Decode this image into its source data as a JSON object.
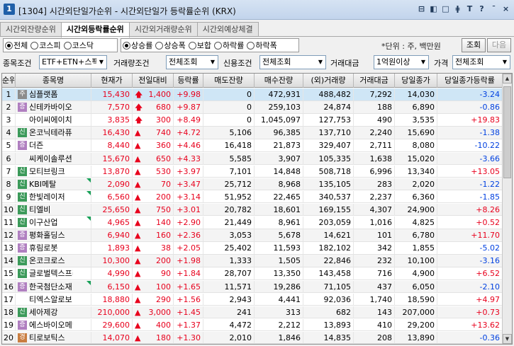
{
  "window": {
    "icon_label": "1",
    "title": "[1304] 시간외단일가순위 - 시간외단일가 등락률순위 (KRX)",
    "buttons": [
      "⊟",
      "◧",
      "□",
      "ǂ",
      "T",
      "?",
      "ˉ",
      "×"
    ]
  },
  "tabs": [
    "시간외잔량순위",
    "시간외등락률순위",
    "시간외거래량순위",
    "시간외예상체결"
  ],
  "active_tab": 1,
  "market_radios": [
    {
      "label": "전체",
      "on": true
    },
    {
      "label": "코스피",
      "on": false
    },
    {
      "label": "코스닥",
      "on": false
    },
    {
      "label": "ETF+ETN+스팩 제외",
      "on": false
    }
  ],
  "direction_radios": [
    {
      "label": "상승률",
      "on": true
    },
    {
      "label": "상승폭",
      "on": false
    },
    {
      "label": "보합",
      "on": false
    },
    {
      "label": "하락률",
      "on": false
    },
    {
      "label": "하락폭",
      "on": false
    }
  ],
  "unit_text": "*단위 : 주, 백만원",
  "query_button": "조회",
  "next_button": "다음",
  "filters": {
    "stock_cond_label": "종목조건",
    "stock_cond_value": "ETF+ETN+스팩 제외",
    "volume_cond_label": "거래량조건",
    "volume_cond_value": "전체조회",
    "credit_cond_label": "신용조건",
    "credit_cond_value": "전체조회",
    "amount_label": "거래대금",
    "amount_value": "1억원이상",
    "price_label": "가격",
    "price_value": "전체조회"
  },
  "columns": [
    "순위",
    "종목명",
    "현재가",
    "전일대비",
    "등락률",
    "매도잔량",
    "매수잔량",
    "(외)거래량",
    "거래대금",
    "당일종가",
    "당일종가등락률"
  ],
  "rows": [
    {
      "rank": "1",
      "badge": "주",
      "badge_type": "ju",
      "name": "심플랫폼",
      "corner": false,
      "price": "15,430",
      "arrow": "🡅",
      "arrow_type": "limit",
      "change": "1,400",
      "rate": "+9.98",
      "sell": "0",
      "buy": "472,931",
      "volume": "488,482",
      "amount": "7,292",
      "close": "14,030",
      "close_rate": "-3.24",
      "close_color": "blue"
    },
    {
      "rank": "2",
      "badge": "증",
      "badge_type": "jeung",
      "name": "신테카바이오",
      "corner": false,
      "price": "7,570",
      "arrow": "🡅",
      "arrow_type": "limit",
      "change": "680",
      "rate": "+9.87",
      "sell": "0",
      "buy": "259,103",
      "volume": "24,874",
      "amount": "188",
      "close": "6,890",
      "close_rate": "-0.86",
      "close_color": "blue"
    },
    {
      "rank": "3",
      "badge": "",
      "badge_type": "",
      "name": "아이씨에이치",
      "corner": false,
      "price": "3,835",
      "arrow": "🡅",
      "arrow_type": "limit",
      "change": "300",
      "rate": "+8.49",
      "sell": "0",
      "buy": "1,045,097",
      "volume": "127,753",
      "amount": "490",
      "close": "3,535",
      "close_rate": "+19.83",
      "close_color": "red"
    },
    {
      "rank": "4",
      "badge": "신",
      "badge_type": "sin",
      "name": "온코닉테라퓨",
      "corner": false,
      "price": "16,430",
      "arrow": "▲",
      "arrow_type": "up",
      "change": "740",
      "rate": "+4.72",
      "sell": "5,106",
      "buy": "96,385",
      "volume": "137,710",
      "amount": "2,240",
      "close": "15,690",
      "close_rate": "-1.38",
      "close_color": "blue"
    },
    {
      "rank": "5",
      "badge": "증",
      "badge_type": "jeung",
      "name": "더즌",
      "corner": false,
      "price": "8,440",
      "arrow": "▲",
      "arrow_type": "up",
      "change": "360",
      "rate": "+4.46",
      "sell": "16,418",
      "buy": "21,873",
      "volume": "329,407",
      "amount": "2,711",
      "close": "8,080",
      "close_rate": "-10.22",
      "close_color": "blue"
    },
    {
      "rank": "6",
      "badge": "",
      "badge_type": "",
      "name": "씨케이솔루션",
      "corner": false,
      "price": "15,670",
      "arrow": "▲",
      "arrow_type": "up",
      "change": "650",
      "rate": "+4.33",
      "sell": "5,585",
      "buy": "3,907",
      "volume": "105,335",
      "amount": "1,638",
      "close": "15,020",
      "close_rate": "-3.66",
      "close_color": "blue"
    },
    {
      "rank": "7",
      "badge": "신",
      "badge_type": "sin",
      "name": "모티브링크",
      "corner": false,
      "price": "13,870",
      "arrow": "▲",
      "arrow_type": "up",
      "change": "530",
      "rate": "+3.97",
      "sell": "7,101",
      "buy": "14,848",
      "volume": "508,718",
      "amount": "6,996",
      "close": "13,340",
      "close_rate": "+13.05",
      "close_color": "red"
    },
    {
      "rank": "8",
      "badge": "신",
      "badge_type": "sin",
      "name": "KBI메탈",
      "corner": true,
      "price": "2,090",
      "arrow": "▲",
      "arrow_type": "up",
      "change": "70",
      "rate": "+3.47",
      "sell": "25,712",
      "buy": "8,968",
      "volume": "135,105",
      "amount": "283",
      "close": "2,020",
      "close_rate": "-1.22",
      "close_color": "blue"
    },
    {
      "rank": "9",
      "badge": "신",
      "badge_type": "sin",
      "name": "한빛레이저",
      "corner": true,
      "price": "6,560",
      "arrow": "▲",
      "arrow_type": "up",
      "change": "200",
      "rate": "+3.14",
      "sell": "51,952",
      "buy": "22,465",
      "volume": "340,537",
      "amount": "2,237",
      "close": "6,360",
      "close_rate": "-1.85",
      "close_color": "blue"
    },
    {
      "rank": "10",
      "badge": "신",
      "badge_type": "sin",
      "name": "티엘비",
      "corner": false,
      "price": "25,650",
      "arrow": "▲",
      "arrow_type": "up",
      "change": "750",
      "rate": "+3.01",
      "sell": "20,782",
      "buy": "18,601",
      "volume": "169,155",
      "amount": "4,307",
      "close": "24,900",
      "close_rate": "+8.26",
      "close_color": "red"
    },
    {
      "rank": "11",
      "badge": "신",
      "badge_type": "sin",
      "name": "이구산업",
      "corner": true,
      "price": "4,965",
      "arrow": "▲",
      "arrow_type": "up",
      "change": "140",
      "rate": "+2.90",
      "sell": "21,449",
      "buy": "8,961",
      "volume": "203,059",
      "amount": "1,016",
      "close": "4,825",
      "close_rate": "+0.52",
      "close_color": "red"
    },
    {
      "rank": "12",
      "badge": "증",
      "badge_type": "jeung",
      "name": "평화홀딩스",
      "corner": false,
      "price": "6,940",
      "arrow": "▲",
      "arrow_type": "up",
      "change": "160",
      "rate": "+2.36",
      "sell": "3,053",
      "buy": "5,678",
      "volume": "14,621",
      "amount": "101",
      "close": "6,780",
      "close_rate": "+11.70",
      "close_color": "red"
    },
    {
      "rank": "13",
      "badge": "증",
      "badge_type": "jeung",
      "name": "휴림로봇",
      "corner": false,
      "price": "1,893",
      "arrow": "▲",
      "arrow_type": "up",
      "change": "38",
      "rate": "+2.05",
      "sell": "25,402",
      "buy": "11,593",
      "volume": "182,102",
      "amount": "342",
      "close": "1,855",
      "close_rate": "-5.02",
      "close_color": "blue"
    },
    {
      "rank": "14",
      "badge": "신",
      "badge_type": "sin",
      "name": "온코크로스",
      "corner": false,
      "price": "10,300",
      "arrow": "▲",
      "arrow_type": "up",
      "change": "200",
      "rate": "+1.98",
      "sell": "1,333",
      "buy": "1,505",
      "volume": "22,846",
      "amount": "232",
      "close": "10,100",
      "close_rate": "-3.16",
      "close_color": "blue"
    },
    {
      "rank": "15",
      "badge": "신",
      "badge_type": "sin",
      "name": "글로벌텍스프리",
      "corner": false,
      "price": "4,990",
      "arrow": "▲",
      "arrow_type": "up",
      "change": "90",
      "rate": "+1.84",
      "sell": "28,707",
      "buy": "13,350",
      "volume": "143,458",
      "amount": "716",
      "close": "4,900",
      "close_rate": "+6.52",
      "close_color": "red"
    },
    {
      "rank": "16",
      "badge": "증",
      "badge_type": "jeung",
      "name": "한국첨단소재",
      "corner": true,
      "price": "6,150",
      "arrow": "▲",
      "arrow_type": "up",
      "change": "100",
      "rate": "+1.65",
      "sell": "11,571",
      "buy": "19,286",
      "volume": "71,105",
      "amount": "437",
      "close": "6,050",
      "close_rate": "-2.10",
      "close_color": "blue"
    },
    {
      "rank": "17",
      "badge": "",
      "badge_type": "",
      "name": "티엑스알로보",
      "corner": false,
      "price": "18,880",
      "arrow": "▲",
      "arrow_type": "up",
      "change": "290",
      "rate": "+1.56",
      "sell": "2,943",
      "buy": "4,441",
      "volume": "92,036",
      "amount": "1,740",
      "close": "18,590",
      "close_rate": "+4.97",
      "close_color": "red"
    },
    {
      "rank": "18",
      "badge": "신",
      "badge_type": "sin",
      "name": "세아제강",
      "corner": false,
      "price": "210,000",
      "arrow": "▲",
      "arrow_type": "up",
      "change": "3,000",
      "rate": "+1.45",
      "sell": "241",
      "buy": "313",
      "volume": "682",
      "amount": "143",
      "close": "207,000",
      "close_rate": "+0.73",
      "close_color": "red"
    },
    {
      "rank": "19",
      "badge": "증",
      "badge_type": "jeung",
      "name": "에스바이오메딕",
      "corner": false,
      "price": "29,600",
      "arrow": "▲",
      "arrow_type": "up",
      "change": "400",
      "rate": "+1.37",
      "sell": "4,472",
      "buy": "2,212",
      "volume": "13,893",
      "amount": "410",
      "close": "29,200",
      "close_rate": "+13.62",
      "close_color": "red"
    },
    {
      "rank": "20",
      "badge": "경",
      "badge_type": "gyeong",
      "name": "티로보틱스",
      "corner": false,
      "price": "14,070",
      "arrow": "▲",
      "arrow_type": "up",
      "change": "180",
      "rate": "+1.30",
      "sell": "2,010",
      "buy": "1,846",
      "volume": "14,835",
      "amount": "208",
      "close": "13,890",
      "close_rate": "-0.36",
      "close_color": "blue"
    }
  ],
  "colors": {
    "up": "#e8001c",
    "down": "#0040e0",
    "selected_row": "#cfe6f6"
  }
}
